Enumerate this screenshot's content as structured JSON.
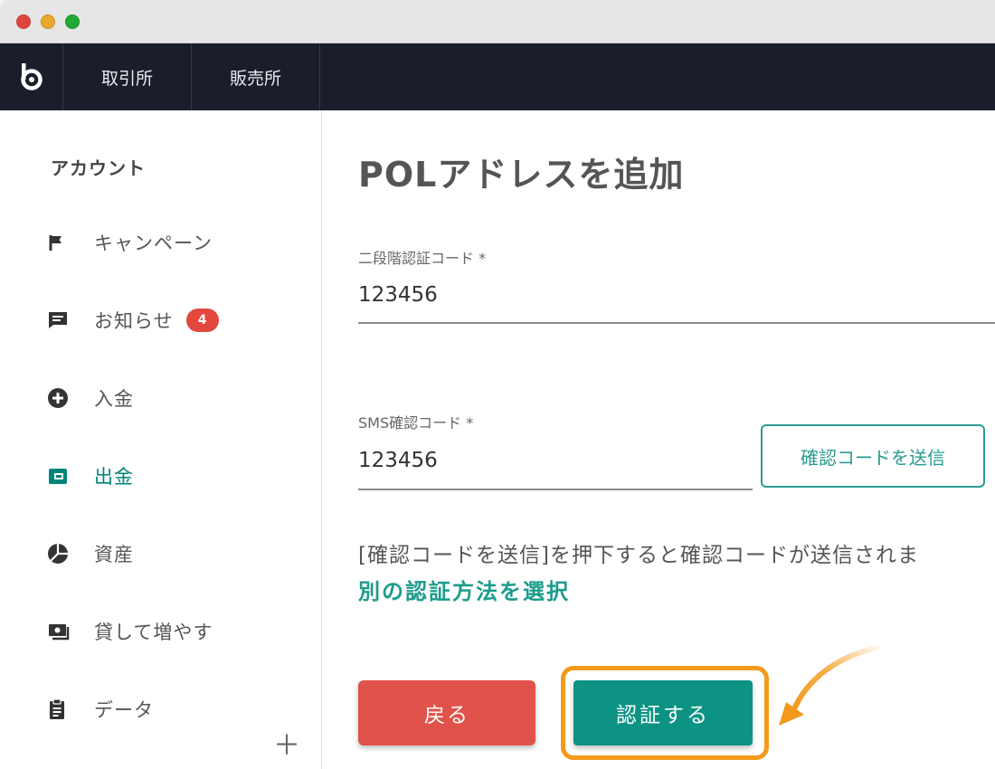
{
  "nav": {
    "tabs": [
      "取引所",
      "販売所"
    ]
  },
  "sidebar": {
    "title": "アカウント",
    "items": [
      {
        "label": "キャンペーン",
        "icon": "flag-icon"
      },
      {
        "label": "お知らせ",
        "icon": "chat-icon",
        "badge": "4"
      },
      {
        "label": "入金",
        "icon": "plus-circle-icon"
      },
      {
        "label": "出金",
        "icon": "wallet-icon",
        "active": true
      },
      {
        "label": "資産",
        "icon": "pie-chart-icon"
      },
      {
        "label": "貸して増やす",
        "icon": "lending-icon"
      },
      {
        "label": "データ",
        "icon": "clipboard-icon"
      }
    ],
    "more_label": "＋"
  },
  "main": {
    "title": "POLアドレスを追加",
    "tfa": {
      "label": "二段階認証コード *",
      "value": "123456"
    },
    "sms": {
      "label": "SMS確認コード *",
      "value": "123456"
    },
    "send_button": "確認コードを送信",
    "info_text": "[確認コードを送信]を押下すると確認コードが送信されま",
    "alt_link": "別の認証方法を選択",
    "back_button": "戻る",
    "verify_button": "認証する"
  },
  "colors": {
    "accent": "#0d9384",
    "danger": "#e0534a",
    "highlight": "#f39a1c",
    "nav_bg": "#1a1e2b",
    "badge": "#e3473d"
  }
}
